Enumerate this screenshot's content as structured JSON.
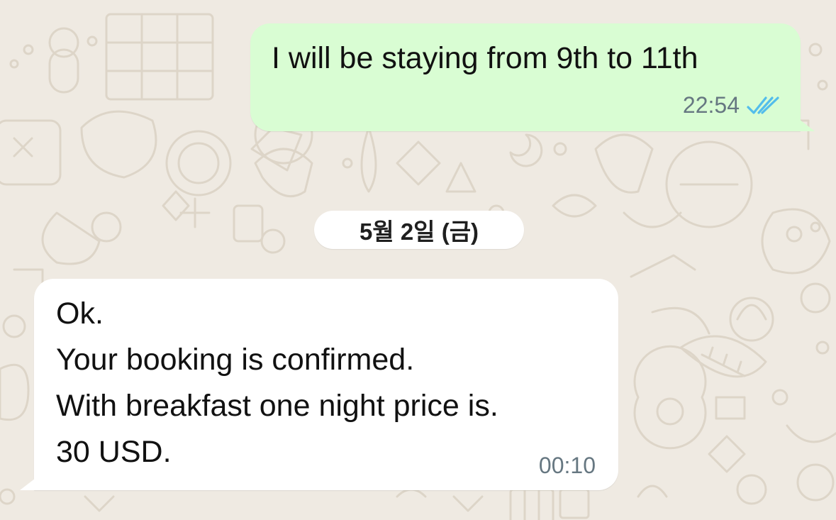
{
  "chat": {
    "background_color": "#efeae2",
    "outgoing_bubble_color": "#d9fdd3",
    "incoming_bubble_color": "#ffffff",
    "read_tick_color": "#53bdeb",
    "messages": [
      {
        "direction": "outgoing",
        "text": "I will be staying from 9th to 11th",
        "time": "22:54",
        "status_icon": "double-check-read-icon"
      },
      {
        "direction": "incoming",
        "text": "Ok.\nYour booking is confirmed.\nWith breakfast one night price is.\n30 USD.",
        "time": "00:10"
      }
    ],
    "date_separator": "5월 2일 (금)"
  }
}
